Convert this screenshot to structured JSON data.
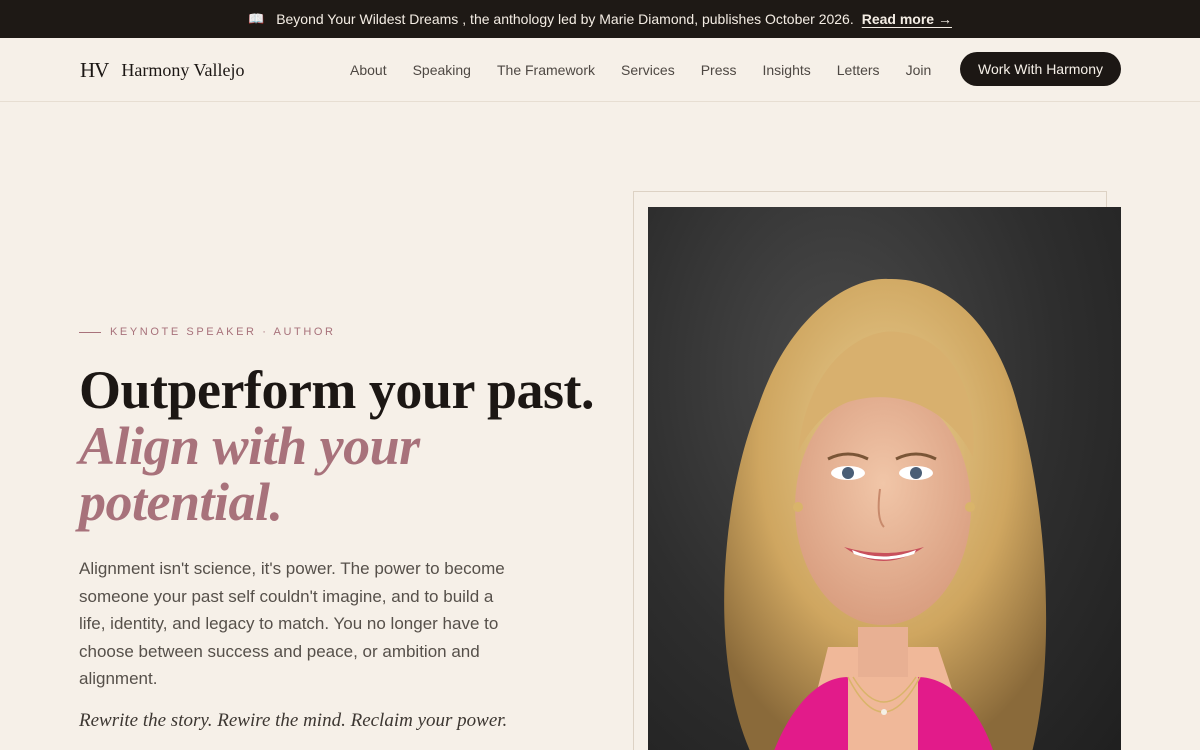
{
  "announcement": {
    "icon": "book-icon",
    "book_glyph": "📖",
    "title": "Beyond Your Wildest Dreams",
    "text": ", the anthology led by Marie Diamond, publishes October 2026.",
    "link": "Read more →"
  },
  "nav": {
    "monogram": "HV",
    "brand": "Harmony Vallejo",
    "items": [
      "About",
      "Speaking",
      "The Framework",
      "Services",
      "Press",
      "Insights",
      "Letters",
      "Join"
    ],
    "cta": "Work With Harmony"
  },
  "hero": {
    "eyebrow": "KEYNOTE SPEAKER · AUTHOR",
    "headline_plain": "Outperform your past.",
    "headline_italic": "Align with your potential.",
    "body": "Alignment isn't science, it's power. The power to become someone your past self couldn't imagine, and to build a life, identity, and legacy to match. You no longer have to choose between success and peace, or ambition and alignment.",
    "tagline": "Rewrite the story. Rewire the mind. Reclaim your power."
  },
  "colors": {
    "background": "#f6f0e8",
    "dark": "#1c1714",
    "accent": "#a8727b"
  }
}
